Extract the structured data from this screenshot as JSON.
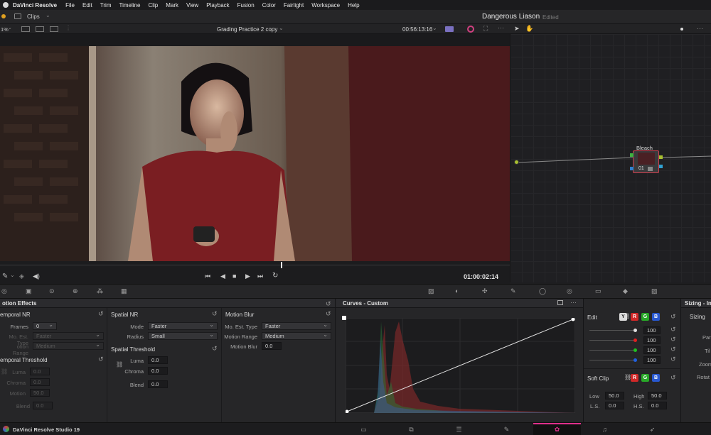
{
  "menubar": {
    "app_name": "DaVinci Resolve",
    "items": [
      "File",
      "Edit",
      "Trim",
      "Timeline",
      "Clip",
      "Mark",
      "View",
      "Playback",
      "Fusion",
      "Color",
      "Fairlight",
      "Workspace",
      "Help"
    ]
  },
  "topbar": {
    "clips_label": "Clips",
    "project_title": "Dangerous Liason",
    "edited_label": "Edited"
  },
  "viewer_bar": {
    "zoom": "1%",
    "clip_name": "Grading Practice 2 copy",
    "timecode_top": "00:56:13:16"
  },
  "transport": {
    "timecode": "01:00:02:14"
  },
  "node": {
    "label": "Bleach",
    "number": "01"
  },
  "motion_effects": {
    "title": "otion Effects",
    "temporal_nr": {
      "title": "emporal NR",
      "frames_label": "Frames",
      "frames_value": "0",
      "mo_est_label": "Mo. Est. Type",
      "mo_est_value": "Faster",
      "motion_range_label": "otion Range",
      "motion_range_value": "Medium"
    },
    "temporal_threshold": {
      "title": "emporal Threshold",
      "luma_label": "Luma",
      "luma_value": "0.0",
      "chroma_label": "Chroma",
      "chroma_value": "0.0",
      "motion_label": "Motion",
      "motion_value": "50.0",
      "blend_label": "Blend",
      "blend_value": "0.0"
    },
    "spatial_nr": {
      "title": "Spatial NR",
      "mode_label": "Mode",
      "mode_value": "Faster",
      "radius_label": "Radius",
      "radius_value": "Small"
    },
    "spatial_threshold": {
      "title": "Spatial Threshold",
      "luma_label": "Luma",
      "luma_value": "0.0",
      "chroma_label": "Chroma",
      "chroma_value": "0.0",
      "blend_label": "Blend",
      "blend_value": "0.0"
    },
    "motion_blur": {
      "title": "Motion Blur",
      "mo_est_label": "Mo. Est. Type",
      "mo_est_value": "Faster",
      "motion_range_label": "Motion Range",
      "motion_range_value": "Medium",
      "motion_blur_label": "Motion Blur",
      "motion_blur_value": "0.0"
    }
  },
  "curves": {
    "title": "Curves - Custom"
  },
  "edit_panel": {
    "title": "Edit",
    "y": "Y",
    "r": "R",
    "g": "G",
    "b": "B",
    "values": [
      "100",
      "100",
      "100",
      "100"
    ],
    "dot_colors": [
      "#e0e0e0",
      "#e02020",
      "#20c020",
      "#2060e0"
    ],
    "soft_clip_title": "Soft Clip",
    "low_label": "Low",
    "low_value": "50.0",
    "high_label": "High",
    "high_value": "50.0",
    "ls_label": "L.S.",
    "ls_value": "0.0",
    "hs_label": "H.S.",
    "hs_value": "0.0"
  },
  "sizing": {
    "title": "Sizing - Inp",
    "sizing_label": "Sizing",
    "par_label": "Par",
    "tilt_label": "Til",
    "zoom_label": "Zoom",
    "rotate_label": "Rotat"
  },
  "statusbar": {
    "app_label": "DaVinci Resolve Studio 19"
  },
  "colors": {
    "accent": "#e0308c",
    "red": "#d02828",
    "green": "#28a828",
    "blue": "#2858d0"
  }
}
